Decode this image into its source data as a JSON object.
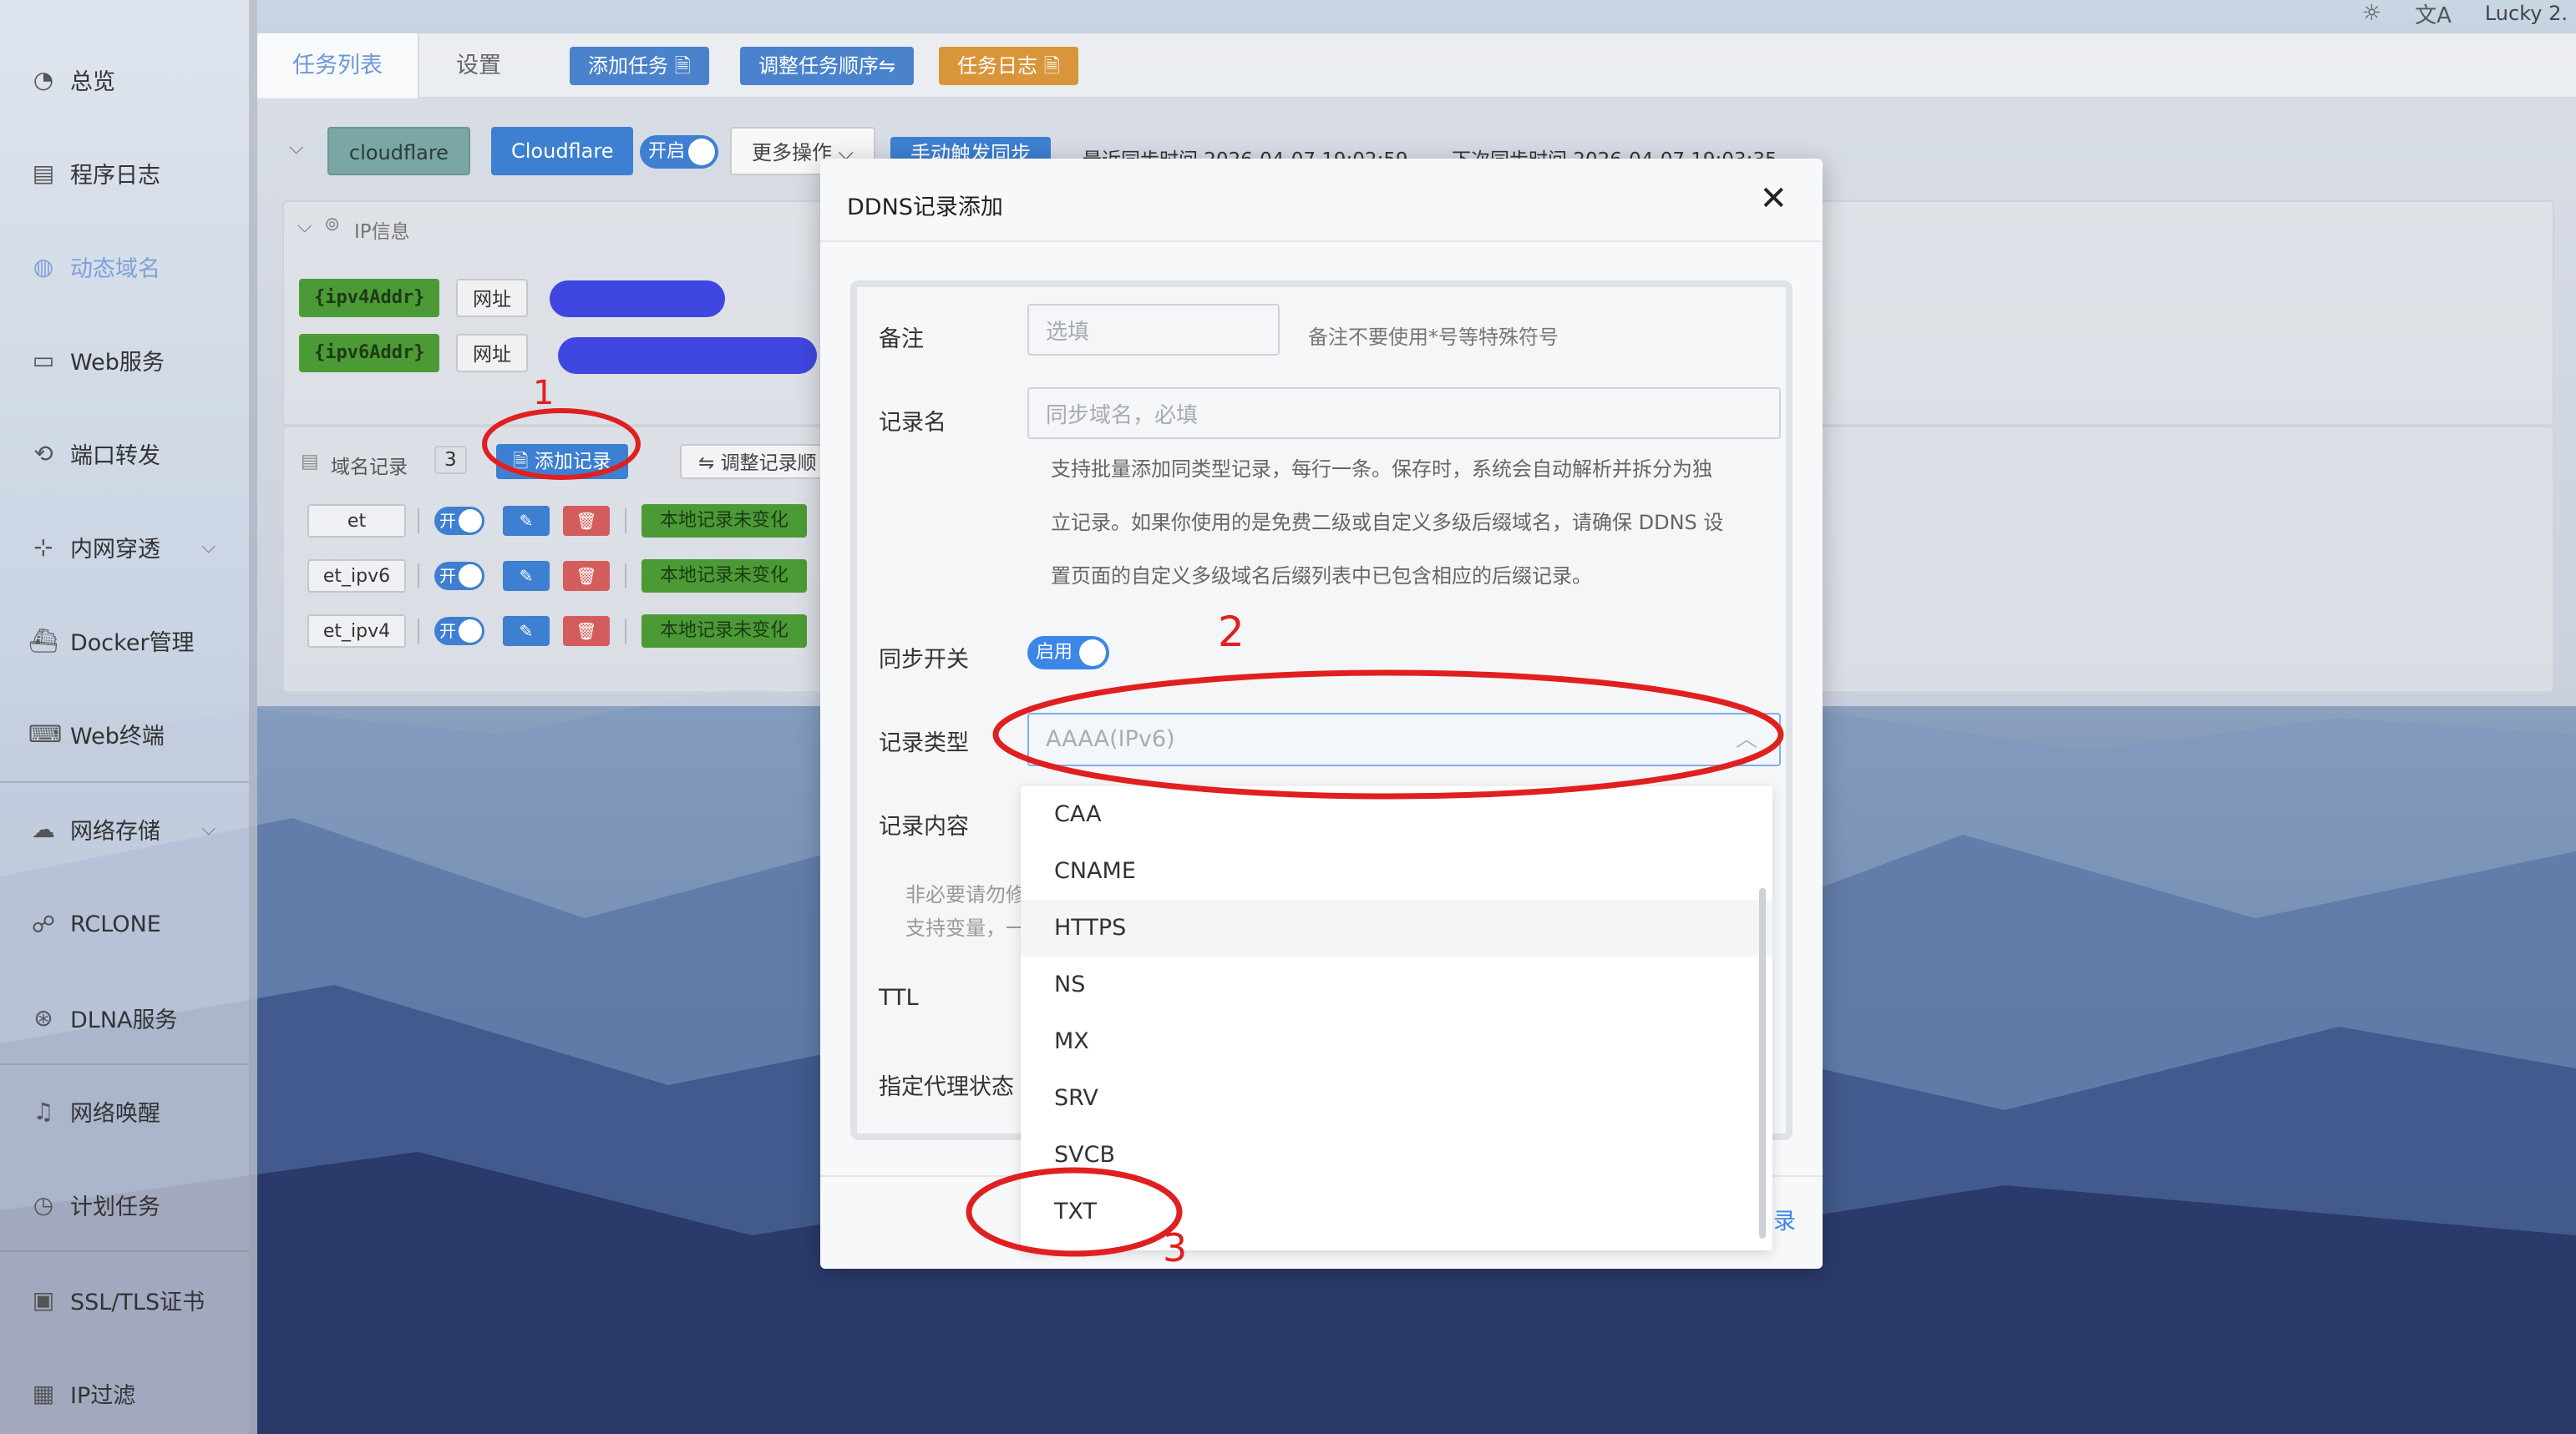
{
  "topbar": {
    "brand": "Lucky 2.",
    "sun_icon": "sun-icon",
    "translate_icon": "translate-icon"
  },
  "sidebar": {
    "items": [
      {
        "label": "总览",
        "icon": "dashboard-icon"
      },
      {
        "label": "程序日志",
        "icon": "log-icon"
      },
      {
        "label": "动态域名",
        "icon": "ddns-icon",
        "active": true
      },
      {
        "label": "Web服务",
        "icon": "web-icon"
      },
      {
        "label": "端口转发",
        "icon": "port-forward-icon"
      },
      {
        "label": "内网穿透",
        "icon": "tunnel-icon",
        "expandable": true
      },
      {
        "label": "Docker管理",
        "icon": "docker-icon"
      },
      {
        "label": "Web终端",
        "icon": "terminal-icon"
      },
      {
        "label": "网络存储",
        "icon": "cloud-storage-icon",
        "expandable": true
      },
      {
        "label": "RCLONE",
        "icon": "rclone-icon"
      },
      {
        "label": "DLNA服务",
        "icon": "dlna-icon"
      },
      {
        "label": "网络唤醒",
        "icon": "bell-icon"
      },
      {
        "label": "计划任务",
        "icon": "clock-icon"
      },
      {
        "label": "SSL/TLS证书",
        "icon": "certificate-icon"
      },
      {
        "label": "IP过滤",
        "icon": "filter-icon"
      }
    ]
  },
  "tabs": {
    "task_list": "任务列表",
    "settings": "设置"
  },
  "header_buttons": {
    "add_task": "添加任务 🗎",
    "adjust_order": "调整任务顺序⇋",
    "task_log": "任务日志 🗎"
  },
  "task": {
    "name_tag": "cloudflare",
    "provider": "Cloudflare",
    "switch_label": "开启",
    "more_ops": "更多操作 ⌵",
    "manual_sync": "手动触发同步",
    "last_sync": "最近同步时间 2026-04-07 19:02:59",
    "next_sync": "下次同步时间 2026-04-07 19:03:35"
  },
  "ip_info": {
    "title": "IP信息",
    "ipv4_tag": "{ipv4Addr}",
    "ipv6_tag": "{ipv6Addr}",
    "addr_label": "网址"
  },
  "records": {
    "title": "域名记录",
    "count": "3",
    "add_button": "添加记录",
    "adjust_button": "调整记录顺",
    "switch_label": "开",
    "rows": [
      {
        "name": "et",
        "status": "本地记录未变化"
      },
      {
        "name": "et_ipv6",
        "status": "本地记录未变化"
      },
      {
        "name": "et_ipv4",
        "status": "本地记录未变化"
      }
    ]
  },
  "modal": {
    "title": "DDNS记录添加",
    "remark_label": "备注",
    "remark_placeholder": "选填",
    "remark_hint": "备注不要使用*号等特殊符号",
    "record_name_label": "记录名",
    "record_name_placeholder": "同步域名，必填",
    "record_desc_1": "支持批量添加同类型记录，每行一条。保存时，系统会自动解析并拆分为独",
    "record_desc_2": "立记录。如果你使用的是免费二级或自定义多级后缀域名，请确保 DDNS 设",
    "record_desc_3": "置页面的自定义多级域名后缀列表中已包含相应的后缀记录。",
    "sync_switch_label": "同步开关",
    "sync_switch_value": "启用",
    "record_type_label": "记录类型",
    "record_type_value": "AAAA(IPv6)",
    "record_content_label": "记录内容",
    "content_hint_1": "非必要请勿修",
    "content_hint_2": "支持变量，一",
    "ttl_label": "TTL",
    "proxy_label": "指定代理状态",
    "footer_link": "录"
  },
  "dropdown": {
    "options": [
      "CAA",
      "CNAME",
      "HTTPS",
      "NS",
      "MX",
      "SRV",
      "SVCB",
      "TXT"
    ],
    "hovered": "HTTPS"
  },
  "annotations": {
    "n1": "1",
    "n2": "2",
    "n3": "3",
    "color": "#e02020"
  }
}
